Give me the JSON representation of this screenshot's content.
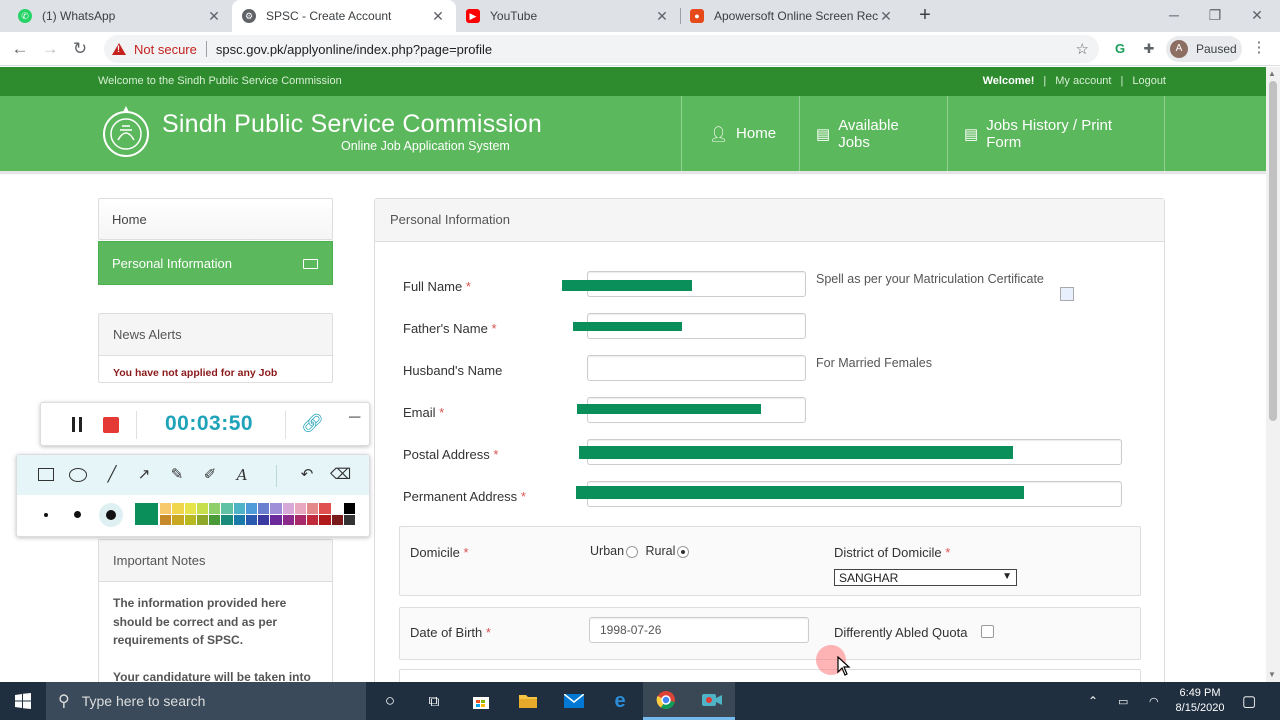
{
  "browser": {
    "tabs": [
      {
        "title": "(1) WhatsApp",
        "icon": "whatsapp-icon",
        "color": "#25d366"
      },
      {
        "title": "SPSC - Create Account",
        "icon": "gear-favicon-icon",
        "color": "#5f6368"
      },
      {
        "title": "YouTube",
        "icon": "youtube-icon",
        "color": "#ff0000"
      },
      {
        "title": "Apowersoft Online Screen Recor",
        "icon": "apowersoft-icon",
        "color": "#e64a19"
      }
    ],
    "security_label": "Not secure",
    "url": "spsc.gov.pk/applyonline/index.php?page=profile",
    "profile_initial": "A",
    "profile_status": "Paused"
  },
  "site": {
    "top_left": "Welcome to the Sindh Public Service Commission",
    "top_right": {
      "welcome": "Welcome!",
      "sep1": "|",
      "account": "My account",
      "sep2": "|",
      "logout": "Logout"
    },
    "title": "Sindh Public Service Commission",
    "subtitle": "Online Job Application System",
    "nav": [
      {
        "label": "Home",
        "icon": "user-icon"
      },
      {
        "label": "Available Jobs",
        "icon": "document-icon"
      },
      {
        "label": "Jobs History / Print Form",
        "icon": "document-icon"
      }
    ],
    "brand_color": "#5cb85c"
  },
  "sidebar": {
    "home": "Home",
    "active": "Personal Information",
    "news_title": "News Alerts",
    "news_text": "You have not applied for any Job",
    "notes_title": "Important Notes",
    "notes_line1": "The information provided here",
    "notes_line2": "should be correct and as per",
    "notes_line3": "requirements of SPSC.",
    "notes_line4": "Your candidature will be taken into"
  },
  "form": {
    "section_title": "Personal Information",
    "required_mark": "*",
    "full_name_label": "Full Name",
    "full_name_hint": "Spell as per your Matriculation Certificate",
    "father_label": "Father's Name",
    "husband_label": "Husband's Name",
    "husband_hint": "For Married Females",
    "email_label": "Email",
    "postal_label": "Postal Address",
    "permanent_label": "Permanent Address",
    "domicile_label": "Domicile",
    "urban_label": "Urban",
    "rural_label": "Rural",
    "domicile_selected": "Rural",
    "district_label": "District of Domicile",
    "district_value": "SANGHAR",
    "dob_label": "Date of Birth",
    "dob_value": "1998-07-26",
    "disabled_quota_label": "Differently Abled Quota"
  },
  "recorder": {
    "time": "00:03:50",
    "palette": [
      "#f7c96a",
      "#f0d64a",
      "#e7e34a",
      "#c7df4a",
      "#8fcf6a",
      "#5fc2a4",
      "#4fb3c8",
      "#4f9ad8",
      "#6a7fd0",
      "#9f8fd8",
      "#d7a9d9",
      "#e8a9c0",
      "#e48a8a",
      "#e05050",
      "#ffffff",
      "#000000",
      "#c68a2a",
      "#c7a820",
      "#b8b820",
      "#8ea82a",
      "#4a9a3a",
      "#1a8a7a",
      "#1a7aa8",
      "#2a5ab0",
      "#3a3aa0",
      "#6a2a9a",
      "#8a2a8a",
      "#a82a6a",
      "#c02a3a",
      "#b01a1a",
      "#7a1a1a",
      "#333333"
    ],
    "selected_color": "#0b8f5a"
  },
  "taskbar": {
    "search_placeholder": "Type here to search",
    "time": "6:49 PM",
    "date": "8/15/2020"
  }
}
